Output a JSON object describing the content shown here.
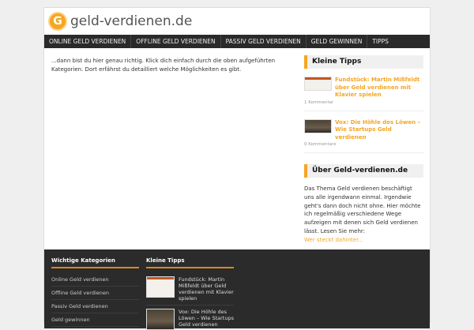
{
  "header": {
    "logo_letter": "G",
    "site_name": "geld-verdienen.de"
  },
  "nav": [
    "ONLINE GELD VERDIENEN",
    "OFFLINE GELD VERDIENEN",
    "PASSIV GELD VERDIENEN",
    "GELD GEWINNEN",
    "TIPPS"
  ],
  "main": {
    "intro": "...dann bist du hier genau richtig. Klick dich einfach durch die oben aufgeführten Kategorien. Dort erfährst du detailliert welche Möglichkeiten es gibt."
  },
  "sidebar": {
    "tips_title": "Kleine Tipps",
    "tips": [
      {
        "title": "Fundstück: Martin Mißfeldt über Geld verdienen mit Klavier spielen",
        "meta": "1 Kommentar"
      },
      {
        "title": "Vox: Die Höhle des Löwen – Wie Startups Geld verdienen",
        "meta": "0 Kommentare"
      }
    ],
    "about_title": "Über Geld-verdienen.de",
    "about_text": "Das Thema Geld verdienen beschäftigt uns alle irgendwann einmal. Irgendwie geht's dann doch nicht ohne. Hier möchte ich regelmäßig verschiedene Wege aufzeigen mit denen sich Geld verdienen lässt. Lesen Sie mehr:",
    "about_link": "Wer steckt dahinter..."
  },
  "footer": {
    "cat_title": "Wichtige Kategorien",
    "categories": [
      "Online Geld verdienen",
      "Offline Geld verdienen",
      "Passiv Geld verdienen",
      "Geld gewinnen"
    ],
    "tips_title": "Kleine Tipps",
    "tips": [
      "Fundstück: Martin Mißfeldt über Geld verdienen mit Klavier spielen",
      "Vox: Die Höhle des Löwen – Wie Startups Geld verdienen"
    ]
  },
  "colors": {
    "accent": "#f5a623",
    "nav": "#2a2a2a",
    "footer": "#2b2b2b"
  }
}
